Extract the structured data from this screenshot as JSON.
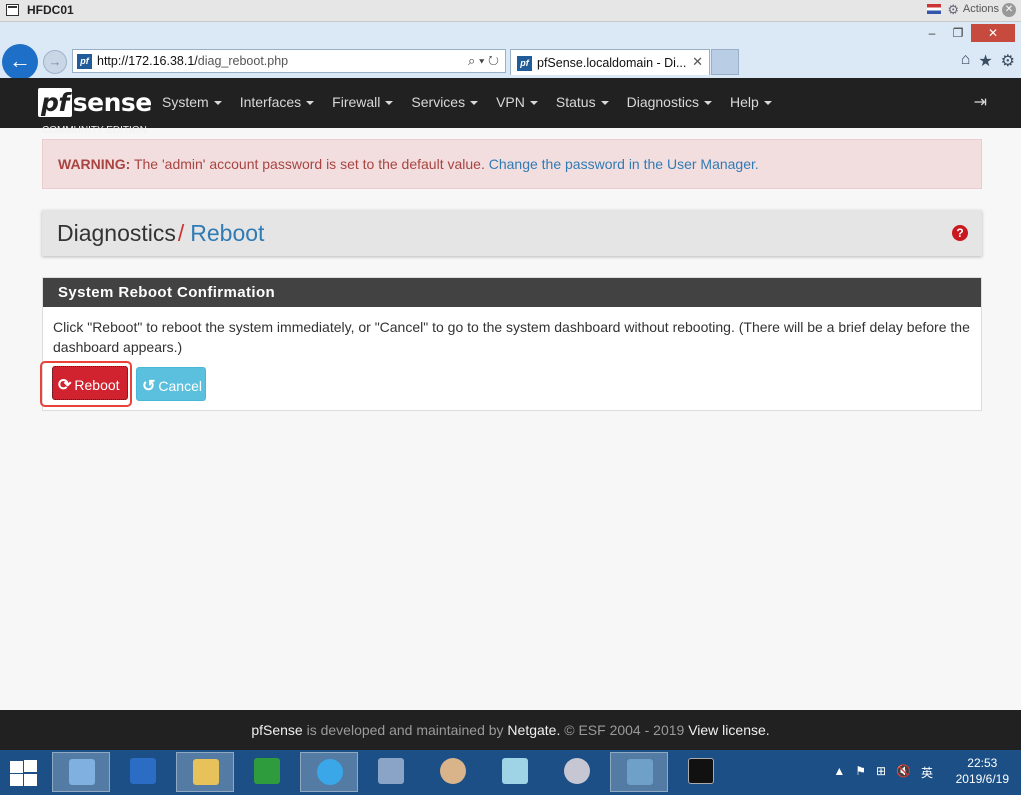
{
  "vm": {
    "title": "HFDC01",
    "actions_label": "Actions"
  },
  "browser": {
    "url_host": "http://172.16.38.1/",
    "url_path": "diag_reboot.php",
    "tab_title": "pfSense.localdomain - Di...",
    "favicon_text": "pf"
  },
  "nav": {
    "logo_pf": "pf",
    "logo_sense": "sense",
    "menu": [
      "System",
      "Interfaces",
      "Firewall",
      "Services",
      "VPN",
      "Status",
      "Diagnostics",
      "Help"
    ],
    "sub_label": "COMMUNITY EDITION"
  },
  "alert": {
    "strong": "WARNING:",
    "text": " The 'admin' account password is set to the default value. ",
    "link": "Change the password in the User Manager."
  },
  "breadcrumb": {
    "parent": "Diagnostics",
    "sep": "/",
    "current": "Reboot",
    "help_icon": "?"
  },
  "panel": {
    "title": "System Reboot Confirmation",
    "body": "Click \"Reboot\" to reboot the system immediately, or \"Cancel\" to go to the system dashboard without rebooting. (There will be a brief delay before the dashboard appears.)",
    "reboot_label": "Reboot",
    "cancel_label": "Cancel"
  },
  "footer": {
    "brand": "pfSense",
    "mid": " is developed and maintained by ",
    "company": "Netgate.",
    "copy": " © ESF 2004 - 2019 ",
    "license": "View license."
  },
  "taskbar": {
    "time": "22:53",
    "date": "2019/6/19",
    "ime": "英"
  },
  "colors": {
    "danger": "#d0232f",
    "info": "#5bc0de",
    "navbar": "#212121",
    "link": "#317bb5"
  }
}
